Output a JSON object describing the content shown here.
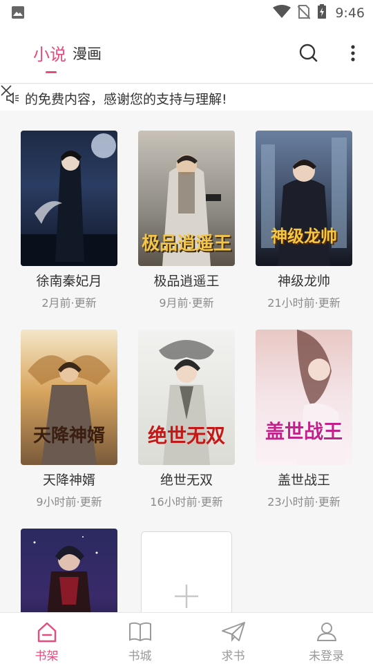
{
  "status_bar": {
    "time": "9:46",
    "icons": [
      "image-icon",
      "wifi-icon",
      "no-sim-icon",
      "battery-charging-icon"
    ]
  },
  "header": {
    "tabs": [
      {
        "label": "小说",
        "active": true
      },
      {
        "label": "漫画",
        "active": false
      }
    ],
    "accent_color": "#e94a7e"
  },
  "notice": {
    "text": "的免费内容，感谢您的支持与理解!"
  },
  "books": [
    {
      "title": "徐南秦妃月",
      "updated": "2月前·更新",
      "cover_title": ""
    },
    {
      "title": "极品逍遥王",
      "updated": "9月前·更新",
      "cover_title": "极品逍遥王"
    },
    {
      "title": "神级龙帅",
      "updated": "21小时前·更新",
      "cover_title": "神级龙帅"
    },
    {
      "title": "天降神婿",
      "updated": "9小时前·更新",
      "cover_title": "天降神婿"
    },
    {
      "title": "绝世无双",
      "updated": "16小时前·更新",
      "cover_title": "绝世无双"
    },
    {
      "title": "盖世战王",
      "updated": "23小时前·更新",
      "cover_title": "盖世战王"
    }
  ],
  "bottom_nav": [
    {
      "label": "书架",
      "icon": "bookshelf-icon",
      "active": true
    },
    {
      "label": "书城",
      "icon": "book-icon",
      "active": false
    },
    {
      "label": "求书",
      "icon": "paper-plane-icon",
      "active": false
    },
    {
      "label": "未登录",
      "icon": "user-icon",
      "active": false
    }
  ]
}
